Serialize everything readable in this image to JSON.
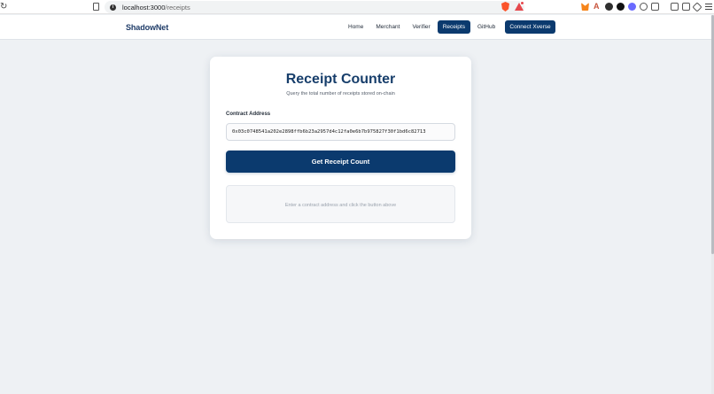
{
  "browser": {
    "url_host": "localhost:3000",
    "url_path": "/receipts"
  },
  "header": {
    "brand": "ShadowNet",
    "nav": [
      {
        "label": "Home",
        "active": false
      },
      {
        "label": "Merchant",
        "active": false
      },
      {
        "label": "Verifier",
        "active": false
      },
      {
        "label": "Receipts",
        "active": true
      },
      {
        "label": "GitHub",
        "active": false
      }
    ],
    "connect_label": "Connect Xverse"
  },
  "card": {
    "title": "Receipt Counter",
    "subtitle": "Query the total number of receipts stored on-chain",
    "field_label": "Contract Address",
    "address_value": "0x03c0748541a202e2898ffb6b23a2957d4c12fa0e6b7b975827f30f1bd6c82713",
    "button_label": "Get Receipt Count",
    "result_placeholder": "Enter a contract address and click the button above"
  },
  "colors": {
    "brand": "#1f3c68",
    "accent": "#0b3a6e",
    "background": "#eef1f4"
  }
}
